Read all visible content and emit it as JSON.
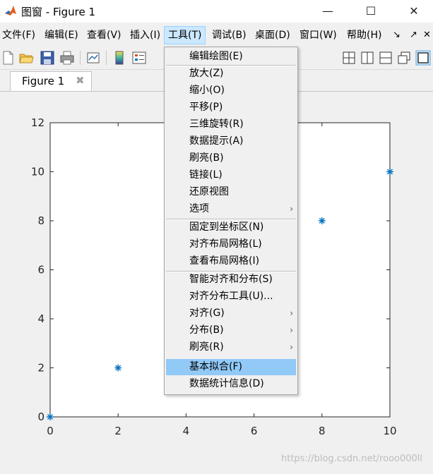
{
  "window": {
    "title": "图窗 - Figure 1",
    "minimize_glyph": "—",
    "maximize_glyph": "☐",
    "close_glyph": "✕"
  },
  "menubar": {
    "items": [
      "文件(F)",
      "编辑(E)",
      "查看(V)",
      "插入(I)",
      "工具(T)",
      "调试(B)",
      "桌面(D)",
      "窗口(W)",
      "帮助(H)"
    ],
    "active": "工具(T)",
    "extra_glyphs": [
      "↘",
      "↗",
      "✕"
    ]
  },
  "toolbar": {
    "icons": [
      "new-figure-icon",
      "open-file-icon",
      "save-icon",
      "print-icon",
      "link-plot-icon",
      "colorbar-icon",
      "legend-icon"
    ],
    "layout_icons": [
      "tile-icon",
      "left-right-icon",
      "top-bottom-icon",
      "float-icon",
      "dock-icon"
    ]
  },
  "tab": {
    "label": "Figure 1",
    "close_glyph": "✖"
  },
  "tools_menu": {
    "items": [
      {
        "label": "编辑绘图(E)"
      },
      {
        "label": "放大(Z)"
      },
      {
        "label": "缩小(O)"
      },
      {
        "label": "平移(P)"
      },
      {
        "label": "三维旋转(R)"
      },
      {
        "label": "数据提示(A)"
      },
      {
        "label": "刷亮(B)"
      },
      {
        "label": "链接(L)"
      },
      {
        "label": "还原视图"
      },
      {
        "label": "选项",
        "submenu": true
      },
      {
        "label": "固定到坐标区(N)"
      },
      {
        "label": "对齐布局网格(L)"
      },
      {
        "label": "查看布局网格(I)"
      },
      {
        "label": "智能对齐和分布(S)"
      },
      {
        "label": "对齐分布工具(U)..."
      },
      {
        "label": "对齐(G)",
        "submenu": true
      },
      {
        "label": "分布(B)",
        "submenu": true
      },
      {
        "label": "刷亮(R)",
        "submenu": true
      },
      {
        "label": "基本拟合(F)",
        "highlighted": true
      },
      {
        "label": "数据统计信息(D)"
      }
    ],
    "submenu_arrow": "›",
    "highlight_color": "#91c9f7"
  },
  "chart_data": {
    "type": "scatter",
    "marker": "*",
    "marker_color": "#0072bd",
    "x": [
      0,
      2,
      4,
      6,
      8,
      10
    ],
    "y": [
      0,
      2,
      4,
      6,
      8,
      10
    ],
    "xlim": [
      0,
      10
    ],
    "ylim": [
      0,
      12
    ],
    "xticks": [
      "0",
      "2",
      "4",
      "6",
      "8",
      "10"
    ],
    "yticks": [
      "0",
      "2",
      "4",
      "6",
      "8",
      "10",
      "12"
    ],
    "title": "",
    "xlabel": "",
    "ylabel": "",
    "grid": false
  },
  "watermark": "https://blog.csdn.net/rooo000ll"
}
